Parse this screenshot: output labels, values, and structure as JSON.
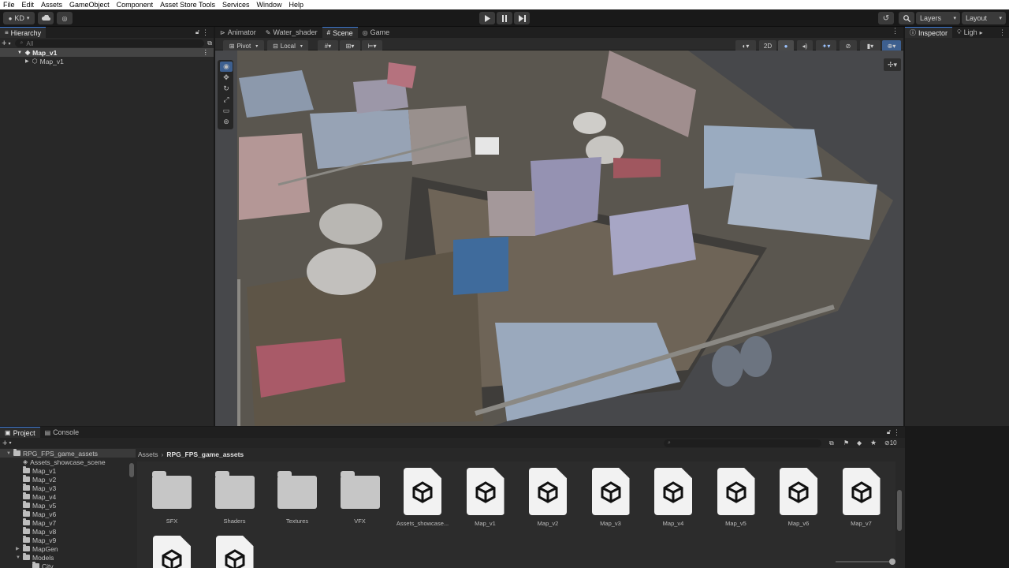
{
  "menu": [
    "File",
    "Edit",
    "Assets",
    "GameObject",
    "Component",
    "Asset Store Tools",
    "Services",
    "Window",
    "Help"
  ],
  "toolbar": {
    "account": "KD",
    "layers": "Layers",
    "layout": "Layout"
  },
  "hierarchy": {
    "tab": "Hierarchy",
    "search_placeholder": "All",
    "root": "Map_v1",
    "child": "Map_v1"
  },
  "scene_tabs": [
    "Animator",
    "Water_shader",
    "Scene",
    "Game"
  ],
  "scene_toolbar": {
    "pivot": "Pivot",
    "space": "Local",
    "mode_2d": "2D"
  },
  "inspector": {
    "tab": "Inspector",
    "tab2": "Ligh"
  },
  "bottom_tabs": {
    "project": "Project",
    "console": "Console"
  },
  "project_tree": [
    {
      "label": "RPG_FPS_game_assets",
      "type": "folder",
      "level": 0
    },
    {
      "label": "Assets_showcase_scene",
      "type": "scene",
      "level": 1
    },
    {
      "label": "Map_v1",
      "type": "folder",
      "level": 1
    },
    {
      "label": "Map_v2",
      "type": "folder",
      "level": 1
    },
    {
      "label": "Map_v3",
      "type": "folder",
      "level": 1
    },
    {
      "label": "Map_v4",
      "type": "folder",
      "level": 1
    },
    {
      "label": "Map_v5",
      "type": "folder",
      "level": 1
    },
    {
      "label": "Map_v6",
      "type": "folder",
      "level": 1
    },
    {
      "label": "Map_v7",
      "type": "folder",
      "level": 1
    },
    {
      "label": "Map_v8",
      "type": "folder",
      "level": 1
    },
    {
      "label": "Map_v9",
      "type": "folder",
      "level": 1
    },
    {
      "label": "MapGen",
      "type": "folder",
      "level": 1
    },
    {
      "label": "Models",
      "type": "folder",
      "level": 1
    },
    {
      "label": "City",
      "type": "folder",
      "level": 2
    }
  ],
  "breadcrumb": [
    "Assets",
    "RPG_FPS_game_assets"
  ],
  "hidden_count": "10",
  "assets": [
    {
      "label": "SFX",
      "type": "folder"
    },
    {
      "label": "Shaders",
      "type": "folder"
    },
    {
      "label": "Textures",
      "type": "folder"
    },
    {
      "label": "VFX",
      "type": "folder"
    },
    {
      "label": "Assets_showcase...",
      "type": "scene"
    },
    {
      "label": "Map_v1",
      "type": "scene"
    },
    {
      "label": "Map_v2",
      "type": "scene"
    },
    {
      "label": "Map_v3",
      "type": "scene"
    },
    {
      "label": "Map_v4",
      "type": "scene"
    },
    {
      "label": "Map_v5",
      "type": "scene"
    },
    {
      "label": "Map_v6",
      "type": "scene"
    },
    {
      "label": "Map_v7",
      "type": "scene"
    }
  ],
  "icons": [
    "play-icon",
    "pause-icon",
    "step-icon",
    "unity-scene-icon",
    "folder-icon",
    "search-icon",
    "cloud-icon",
    "history-icon"
  ],
  "colors": {
    "accent": "#3d7bd8",
    "panel": "#282828",
    "background": "#191919"
  }
}
